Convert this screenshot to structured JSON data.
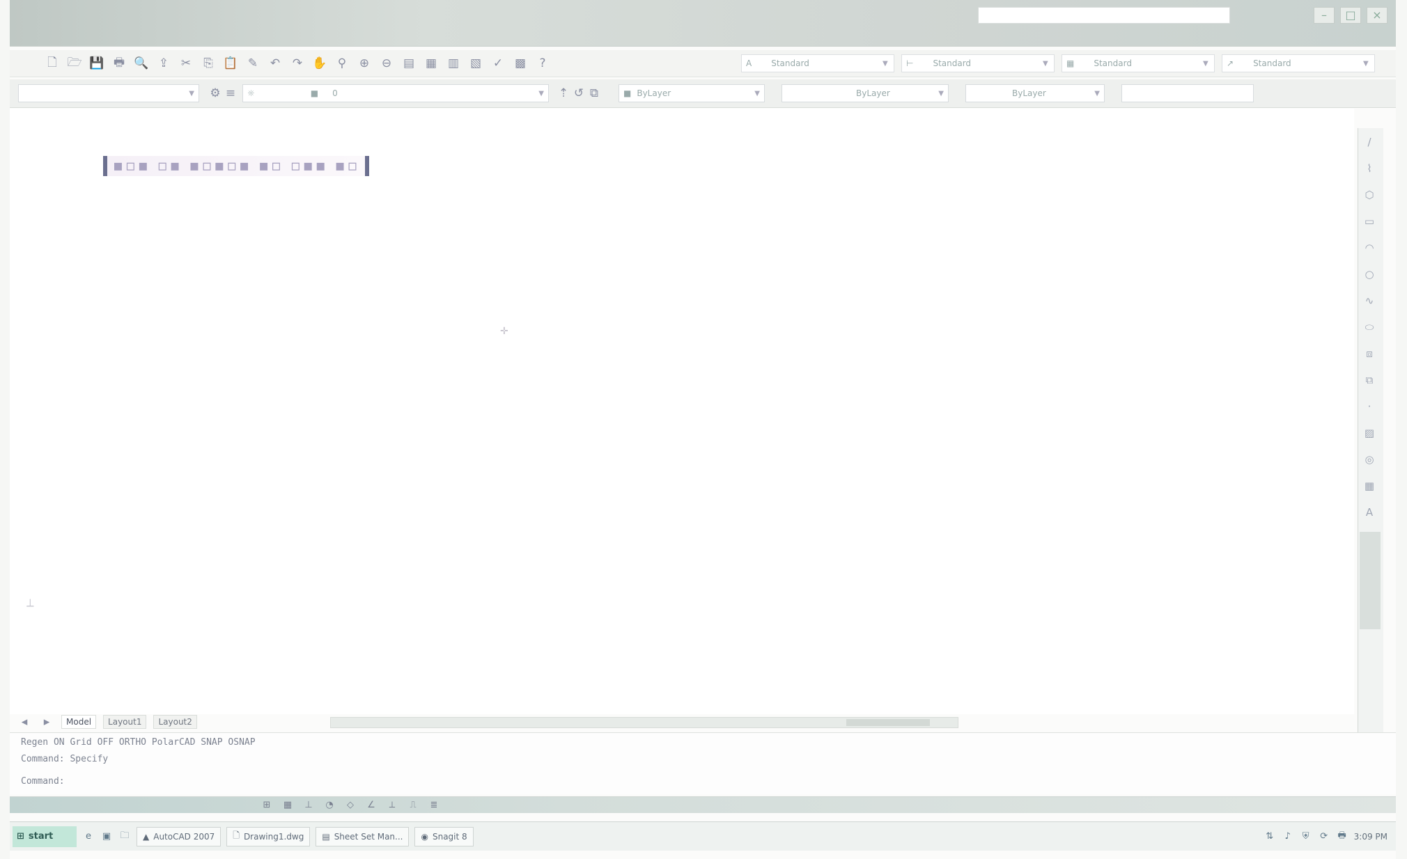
{
  "app": {
    "title_bar": {
      "title": "",
      "search_value": ""
    }
  },
  "toolbar1": {
    "dropdowns": [
      {
        "value": "Standard"
      },
      {
        "value": "Standard"
      },
      {
        "value": "Standard"
      },
      {
        "value": "Standard"
      }
    ]
  },
  "toolbar2": {
    "workspace": "",
    "layer": "0",
    "color": "ByLayer",
    "linetype": "ByLayer",
    "lineweight": "ByLayer"
  },
  "layout_tabs": [
    {
      "label": "Model"
    },
    {
      "label": "Layout1"
    },
    {
      "label": "Layout2"
    }
  ],
  "command_area": {
    "line1": "Regen  ON  Grid  OFF  ORTHO  PolarCAD  SNAP  OSNAP",
    "line2": "Command: Specify",
    "line3": "Command:"
  },
  "taskbar": {
    "start_label": "start",
    "items": [
      {
        "label": "AutoCAD 2007"
      },
      {
        "label": "Drawing1.dwg"
      },
      {
        "label": "Sheet Set Man..."
      },
      {
        "label": "Snagit 8"
      }
    ],
    "clock": "3:09 PM"
  }
}
